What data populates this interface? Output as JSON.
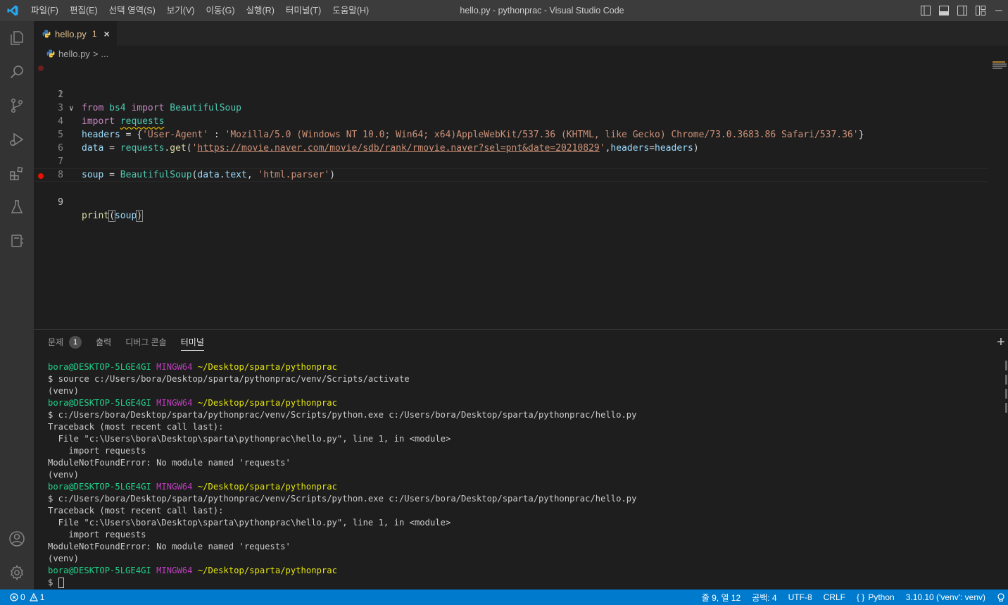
{
  "window": {
    "title": "hello.py - pythonprac - Visual Studio Code",
    "menu": [
      "파일(F)",
      "편집(E)",
      "선택 영역(S)",
      "보기(V)",
      "이동(G)",
      "실행(R)",
      "터미널(T)",
      "도움말(H)"
    ]
  },
  "tab": {
    "filename": "hello.py",
    "problems": "1",
    "close": "×"
  },
  "breadcrumb": {
    "file": "hello.py",
    "separator": ">",
    "rest": "..."
  },
  "editor": {
    "line_numbers": [
      "1",
      "2",
      "3",
      "4",
      "5",
      "6",
      "7",
      "8",
      "9"
    ],
    "fold_marker": "∨",
    "line1": {
      "kw": "import",
      "module": "requests"
    },
    "line2": {
      "kw_from": "from",
      "module": "bs4",
      "kw_import": "import",
      "name": "BeautifulSoup"
    },
    "line4": {
      "var": "headers",
      "op": " = {",
      "key": "'User-Agent'",
      "colon": " : ",
      "value": "'Mozilla/5.0 (Windows NT 10.0; Win64; x64)AppleWebKit/537.36 (KHTML, like Gecko) Chrome/73.0.3683.86 Safari/537.36'",
      "close": "}"
    },
    "line5": {
      "var": "data",
      "op": " = ",
      "module": "requests",
      "dot": ".",
      "fn": "get",
      "paren": "(",
      "quote1": "'",
      "url": "https://movie.naver.com/movie/sdb/rank/rmovie.naver?sel=pnt&date=20210829",
      "quote2": "'",
      "comma": ",",
      "kwarg": "headers",
      "eq": "=",
      "argval": "headers",
      "close": ")"
    },
    "line7": {
      "var": "soup",
      "op": " = ",
      "fn": "BeautifulSoup",
      "paren": "(",
      "arg1": "data",
      "dot": ".",
      "attr": "text",
      "comma": ", ",
      "str": "'html.parser'",
      "close": ")"
    },
    "line9": {
      "fn": "print",
      "paren": "(",
      "arg": "soup",
      "close": ")"
    }
  },
  "panel": {
    "tabs": [
      "문제",
      "출력",
      "디버그 콘솔",
      "터미널"
    ],
    "problems_badge": "1",
    "add": "+"
  },
  "terminal": {
    "prompt_user": "bora@DESKTOP-5LGE4GI",
    "prompt_env": "MINGW64",
    "prompt_path": "~/Desktop/sparta/pythonprac",
    "lines": [
      "$ source c:/Users/bora/Desktop/sparta/pythonprac/venv/Scripts/activate",
      "(venv)",
      "$ c:/Users/bora/Desktop/sparta/pythonprac/venv/Scripts/python.exe c:/Users/bora/Desktop/sparta/pythonprac/hello.py",
      "Traceback (most recent call last):",
      "  File \"c:\\Users\\bora\\Desktop\\sparta\\pythonprac\\hello.py\", line 1, in <module>",
      "    import requests",
      "ModuleNotFoundError: No module named 'requests'",
      "$"
    ]
  },
  "status": {
    "errors": "0",
    "warnings": "1",
    "position": "줄 9, 열 12",
    "spaces": "공백: 4",
    "encoding": "UTF-8",
    "eol": "CRLF",
    "language": "Python",
    "interpreter": "3.10.10 ('venv': venv)"
  },
  "colors": {
    "accent": "#007acc",
    "breakpoint": "#e51400"
  }
}
